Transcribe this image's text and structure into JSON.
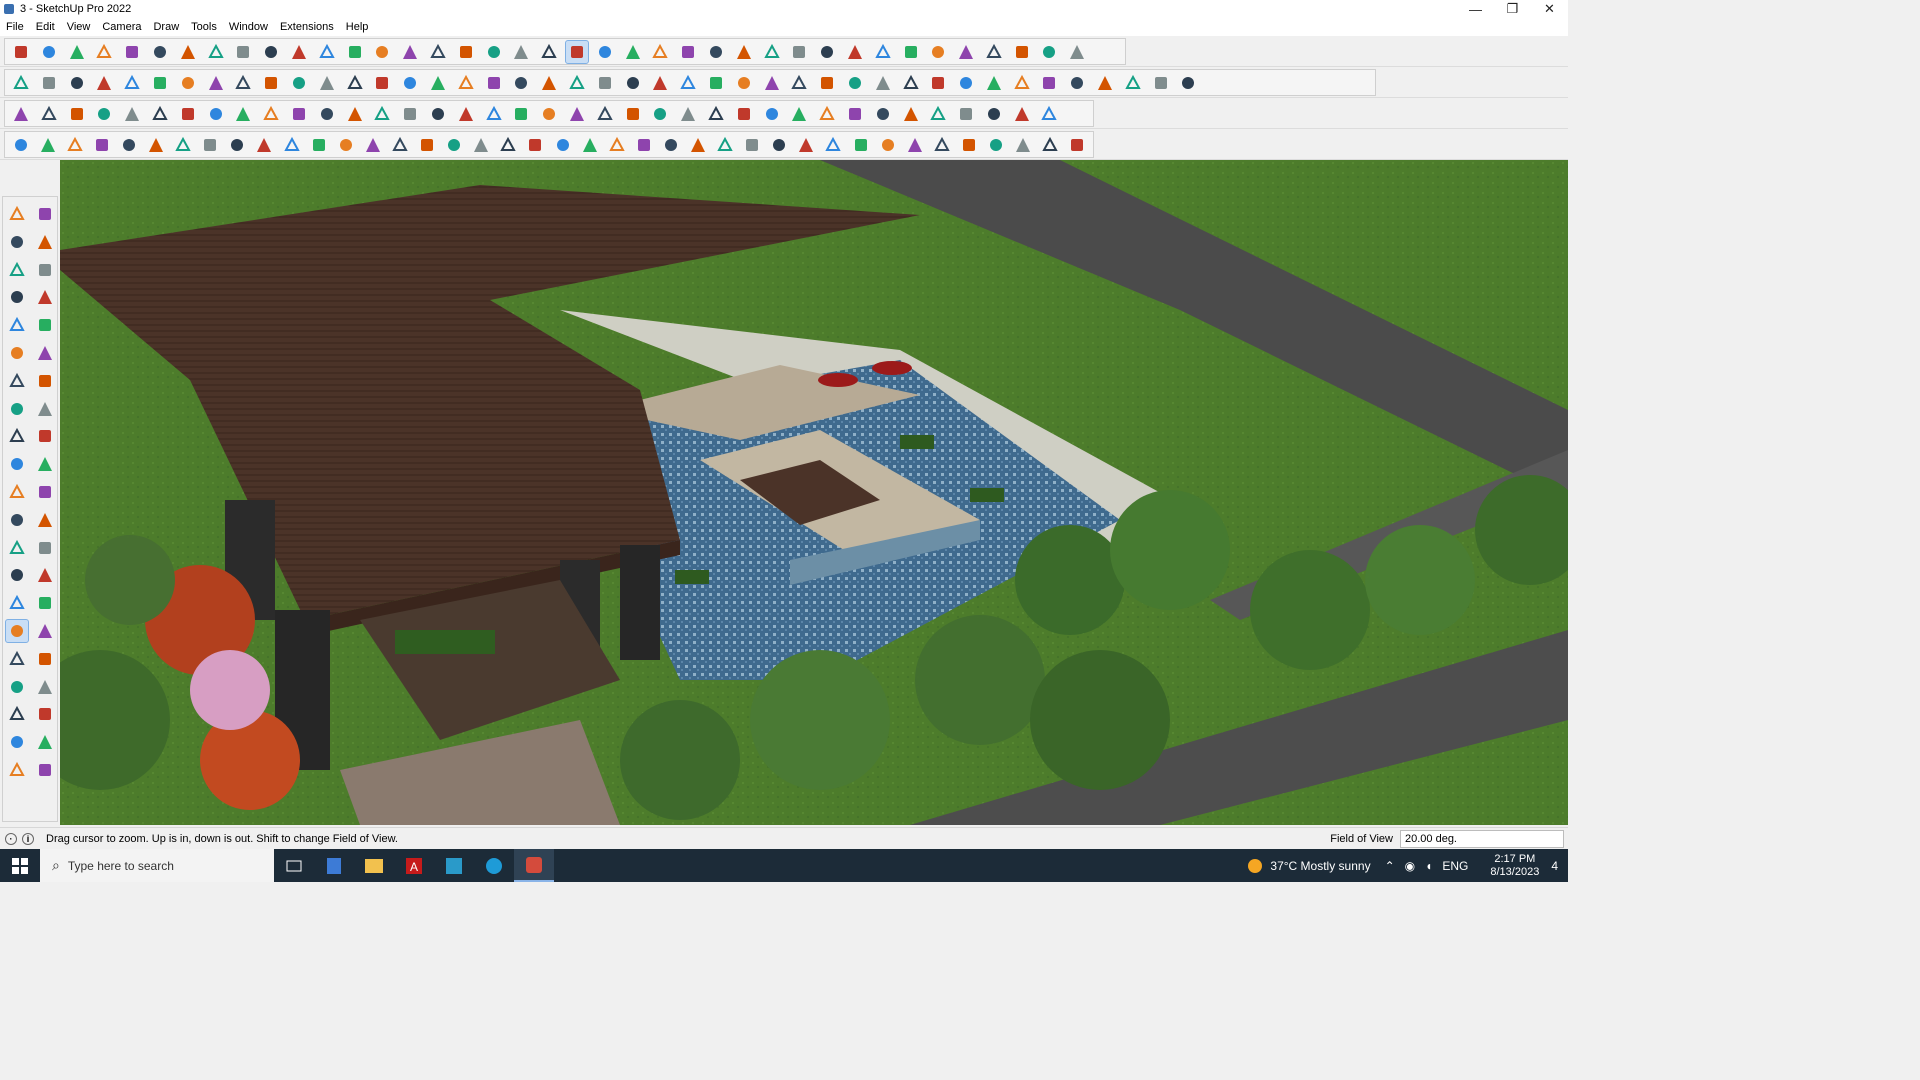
{
  "window": {
    "title": "3 - SketchUp Pro 2022",
    "controls": {
      "minimize": "—",
      "maximize": "❐",
      "close": "✕"
    }
  },
  "menu": [
    "File",
    "Edit",
    "View",
    "Camera",
    "Draw",
    "Tools",
    "Window",
    "Extensions",
    "Help"
  ],
  "toolbar_rows": [
    {
      "icons": [
        "zoom-icon",
        "select-icon",
        "dropdown-icon",
        "eraser-icon",
        "line-icon",
        "dropdown-icon",
        "arc-icon",
        "dropdown-icon",
        "rectangle-icon",
        "dropdown-icon",
        "push-pull-icon",
        "follow-me-icon",
        "move-icon",
        "rotate-icon",
        "scale-icon",
        "tape-measure-icon",
        "text-icon",
        "paint-bucket-icon",
        "orbit-icon",
        "pan-icon",
        "zoom-tool-icon",
        "zoom-extents-icon",
        "warehouse-icon",
        "extension-warehouse-icon",
        "layout-icon",
        "styles-icon",
        "account-icon",
        "dropdown-icon",
        "section-plane-icon",
        "section-fill-icon",
        "axes-icon",
        "sandbox-icon",
        "stamp-icon",
        "drape-icon",
        "flip-icon",
        "add-detail-icon",
        "undo-icon",
        "redo-icon",
        "help-icon"
      ]
    },
    {
      "icons": [
        "components-icon",
        "materials-icon",
        "style-icon",
        "views-icon",
        "top-view-icon",
        "front-view-icon",
        "right-view-icon",
        "back-view-icon",
        "left-view-icon",
        "bottom-view-icon",
        "iso-view-icon",
        "perspective-icon",
        "xray-icon",
        "wireframe-icon",
        "hidden-line-icon",
        "shaded-icon",
        "textured-icon",
        "monochrome-icon",
        "house-icon",
        "house-outline-icon",
        "garage-icon",
        "toolbox-icon",
        "speech-icon",
        "pencil-icon",
        "curve-icon",
        "curve2-icon",
        "curve3-icon",
        "curve4-icon",
        "curve5-icon",
        "curve6-icon",
        "curve7-icon",
        "curve8-icon",
        "lasso-icon",
        "lasso2-icon",
        "red-pencil-icon",
        "pink-eraser-icon",
        "solid-tool-icon",
        "solid-tool2-icon",
        "solid-tool3-icon",
        "solid-tool4-icon",
        "solid-tool5-icon",
        "solid-tool6-icon",
        "solid-tool7-icon"
      ]
    },
    {
      "icons": [
        "face-blue-icon",
        "face-cyan-icon",
        "face-yellow-icon",
        "face-green-icon",
        "face-red-icon",
        "face-white-icon",
        "loop-icon",
        "red-square-icon",
        "ladder-icon",
        "tag-icon",
        "chain-icon",
        "bezier-icon",
        "curve-tool-icon",
        "cross-red-icon",
        "cross-green-icon",
        "cross-blue-icon",
        "cone-icon",
        "fire-icon",
        "warning-icon",
        "hook-icon",
        "cut-icon",
        "spin-icon",
        "arrows-icon",
        "bucket-icon",
        "magnet-icon",
        "tree-icon",
        "robot-icon",
        "robot2-icon",
        "robot3-icon",
        "gift-icon",
        "brain-icon",
        "window-icon",
        "grid-orange-icon",
        "grid-orange2-icon",
        "grid-orange3-icon",
        "explode-icon",
        "dashed-arc-icon",
        "grid-icon"
      ]
    },
    {
      "icons": [
        "curve-a-icon",
        "curve-b-icon",
        "car-icon",
        "knife-icon",
        "gear-icon",
        "plane-icon",
        "hand-icon",
        "tilt-icon",
        "globe-icon",
        "arc-tool-icon",
        "step-icon",
        "step2-icon",
        "slope-icon",
        "slope2-icon",
        "grid-tile-icon",
        "stairs-icon",
        "pen-icon",
        "column-icon",
        "comb-icon",
        "claw-icon",
        "leaf-icon",
        "arrow-icon",
        "stack-icon",
        "ramp-icon",
        "ramp2-icon",
        "ramp3-icon",
        "ramp4-icon",
        "barrel-icon",
        "stairs2-icon",
        "stairs3-icon",
        "stairs4-icon",
        "cube-dark-icon",
        "fence-icon",
        "fence2-icon",
        "fence3-icon",
        "ball-icon",
        "ball2-icon",
        "hatch-icon",
        "fern-icon",
        "shell-icon"
      ]
    }
  ],
  "left_tools": [
    "select-icon",
    "orbit-icon",
    "paint-bucket-icon",
    "eraser-icon",
    "component-icon",
    "tag-icon",
    "line-icon",
    "freehand-icon",
    "rectangle-icon",
    "rotated-rect-icon",
    "circle-icon",
    "polygon-icon",
    "arc-icon",
    "arc-2pt-icon",
    "arc-3pt-icon",
    "pie-icon",
    "move-icon",
    "push-pull-icon",
    "rotate-icon",
    "follow-me-icon",
    "scale-icon",
    "offset-icon",
    "tape-icon",
    "dimension-icon",
    "protractor-icon",
    "text-icon",
    "axes-icon",
    "3d-text-icon",
    "orbit-tool-icon",
    "pan-icon",
    "zoom-icon",
    "zoom-window-icon",
    "zoom-extents-icon",
    "prev-view-icon",
    "position-camera-icon",
    "look-around-icon",
    "walk-icon",
    "section-icon",
    "warehouse-icon",
    "extension-icon",
    "layers-icon",
    "layers2-icon"
  ],
  "status": {
    "message": "Drag cursor to zoom.  Up is in, down is out. Shift to change Field of View.",
    "vcb_label": "Field of View",
    "vcb_value": "20.00 deg."
  },
  "taskbar": {
    "search_placeholder": "Type here to search",
    "weather": "37°C  Mostly sunny",
    "language": "ENG",
    "time": "2:17 PM",
    "date": "8/13/2023",
    "notification_count": "4"
  }
}
